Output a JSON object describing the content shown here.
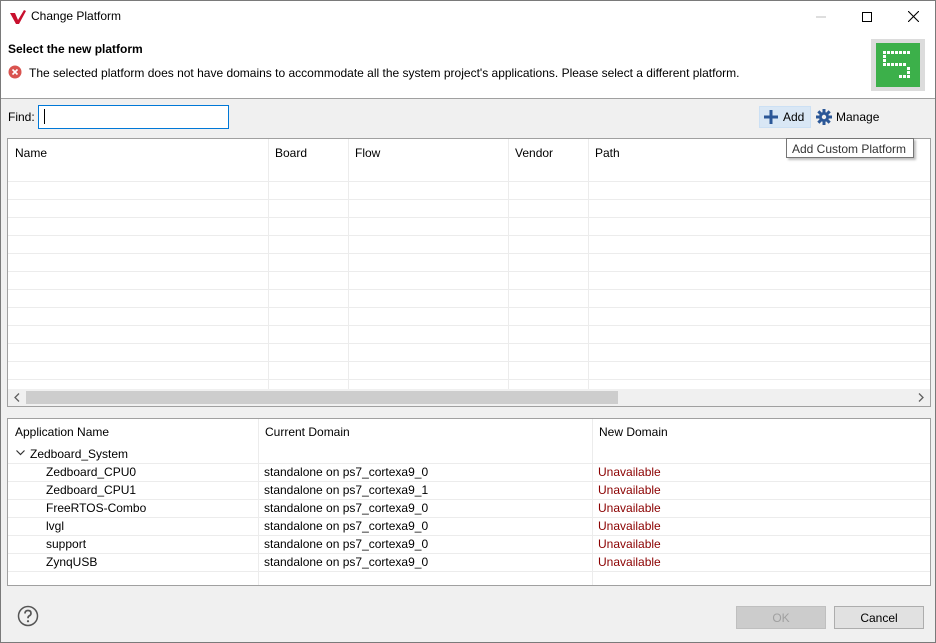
{
  "window": {
    "title": "Change Platform",
    "icons": {
      "app": "vivado-logo-icon",
      "minimize": "minimize-icon",
      "maximize": "maximize-icon",
      "close": "close-icon"
    }
  },
  "header": {
    "title": "Select the new platform",
    "error_message": "The selected platform does not have domains to accommodate all the system project's applications. Please select a different platform.",
    "error_icon": "error-icon",
    "banner_icon": "platform-banner-icon"
  },
  "find": {
    "label": "Find:",
    "value": "",
    "placeholder": ""
  },
  "toolbar": {
    "add_label": "Add",
    "add_icon": "plus-icon",
    "manage_label": "Manage",
    "manage_icon": "gear-icon",
    "tooltip": "Add Custom Platform"
  },
  "platform_table": {
    "columns": [
      "Name",
      "Board",
      "Flow",
      "Vendor",
      "Path"
    ],
    "rows": []
  },
  "app_table": {
    "columns": [
      "Application Name",
      "Current Domain",
      "New Domain"
    ],
    "group": "Zedboard_System",
    "rows": [
      {
        "name": "Zedboard_CPU0",
        "current": "standalone on ps7_cortexa9_0",
        "new": "Unavailable"
      },
      {
        "name": "Zedboard_CPU1",
        "current": "standalone on ps7_cortexa9_1",
        "new": "Unavailable"
      },
      {
        "name": "FreeRTOS-Combo",
        "current": "standalone on ps7_cortexa9_0",
        "new": "Unavailable"
      },
      {
        "name": "lvgl",
        "current": "standalone on ps7_cortexa9_0",
        "new": "Unavailable"
      },
      {
        "name": "support",
        "current": "standalone on ps7_cortexa9_0",
        "new": "Unavailable"
      },
      {
        "name": "ZynqUSB",
        "current": "standalone on ps7_cortexa9_0",
        "new": "Unavailable"
      }
    ]
  },
  "footer": {
    "ok_label": "OK",
    "cancel_label": "Cancel",
    "help_icon": "help-icon"
  },
  "colors": {
    "unavailable": "#8b0000",
    "focus": "#0078d7",
    "banner_green": "#3cb04a"
  }
}
